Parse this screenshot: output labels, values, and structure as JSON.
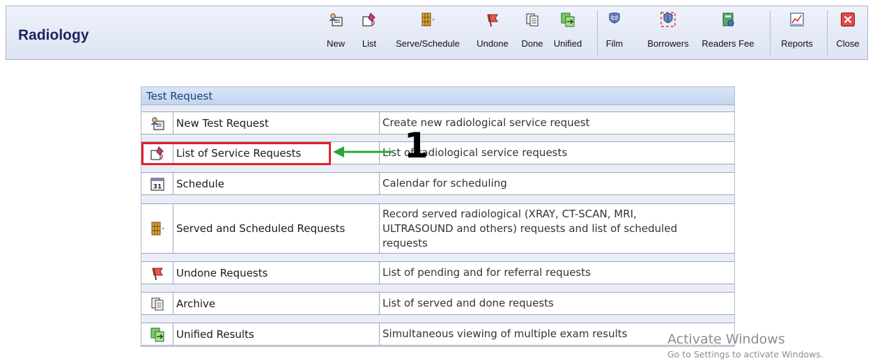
{
  "app": {
    "title": "Radiology"
  },
  "toolbar": {
    "items": [
      {
        "label": "New",
        "icon": "new-request-icon"
      },
      {
        "label": "List",
        "icon": "list-icon"
      },
      {
        "label": "Serve/Schedule",
        "icon": "serve-schedule-icon"
      },
      {
        "label": "Undone",
        "icon": "flag-icon"
      },
      {
        "label": "Done",
        "icon": "done-documents-icon"
      },
      {
        "label": "Unified",
        "icon": "unified-icon"
      },
      {
        "label": "Film",
        "icon": "film-icon"
      },
      {
        "label": "Borrowers",
        "icon": "borrowers-icon"
      },
      {
        "label": "Readers Fee",
        "icon": "readers-fee-icon"
      },
      {
        "label": "Reports",
        "icon": "reports-chart-icon"
      },
      {
        "label": "Close",
        "icon": "close-icon"
      }
    ]
  },
  "panel": {
    "title": "Test Request",
    "rows": [
      {
        "name": "New Test Request",
        "description": "Create new radiological service request",
        "icon": "new-request-icon"
      },
      {
        "name": "List of Service Requests",
        "description": "List of radiological service requests",
        "icon": "list-icon"
      },
      {
        "name": "Schedule",
        "description": "Calendar for scheduling",
        "icon": "calendar-icon"
      },
      {
        "name": "Served and Scheduled Requests",
        "description": "Record served radiological (XRAY, CT-SCAN, MRI, ULTRASOUND and others) requests and list of scheduled requests",
        "icon": "serve-schedule-icon"
      },
      {
        "name": "Undone Requests",
        "description": "List of pending and for referral requests",
        "icon": "flag-icon"
      },
      {
        "name": "Archive",
        "description": "List of served and done requests",
        "icon": "done-documents-icon"
      },
      {
        "name": "Unified Results",
        "description": "Simultaneous viewing of multiple exam results",
        "icon": "unified-icon"
      }
    ]
  },
  "annotation": {
    "number": "1"
  },
  "watermark": {
    "line1": "Activate Windows",
    "line2": "Go to Settings to activate Windows."
  },
  "colors": {
    "highlight": "#e4202a",
    "arrow": "#2aa63a",
    "title": "#1d2560"
  }
}
